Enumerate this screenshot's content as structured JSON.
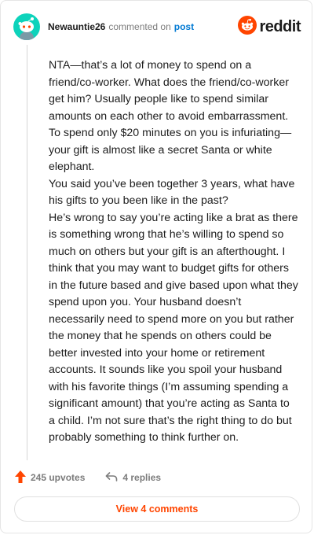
{
  "header": {
    "username": "Newauntie26",
    "action": "commented on",
    "post_link": "post",
    "brand": "reddit"
  },
  "comment": {
    "paragraphs": [
      "NTA—that’s a lot of money to spend on a friend/co-worker. What does the friend/co-worker get him? Usually people like to spend similar amounts on each other to avoid embarrassment. To spend only $20 minutes on you is infuriating—your gift is almost like a secret Santa or white elephant.",
      "You said you’ve been together 3 years, what have his gifts to you been like in the past?",
      "He’s wrong to say you’re acting like a brat as there is something wrong that he’s willing to spend so much on others but your gift is an afterthought. I think that you may want to budget gifts for others in the future based and give based upon what they spend upon you. Your husband doesn’t necessarily need to spend more on you but rather the money that he spends on others could be better invested into your home or retirement accounts. It sounds like you spoil your husband with his favorite things (I’m assuming spending a significant amount) that you’re acting as Santa to a child. I’m not sure that’s the right thing to do but probably something to think further on."
    ]
  },
  "footer": {
    "upvotes": "245 upvotes",
    "replies": "4 replies",
    "view_comments": "View 4 comments"
  },
  "colors": {
    "accent": "#ff4500",
    "link": "#0079d3",
    "avatar_bg": "#0dd3bb"
  },
  "icons": {
    "avatar": "snoo-avatar-icon",
    "brand": "reddit-logo-icon",
    "upvote": "upvote-arrow-icon",
    "reply": "reply-arrow-icon"
  }
}
